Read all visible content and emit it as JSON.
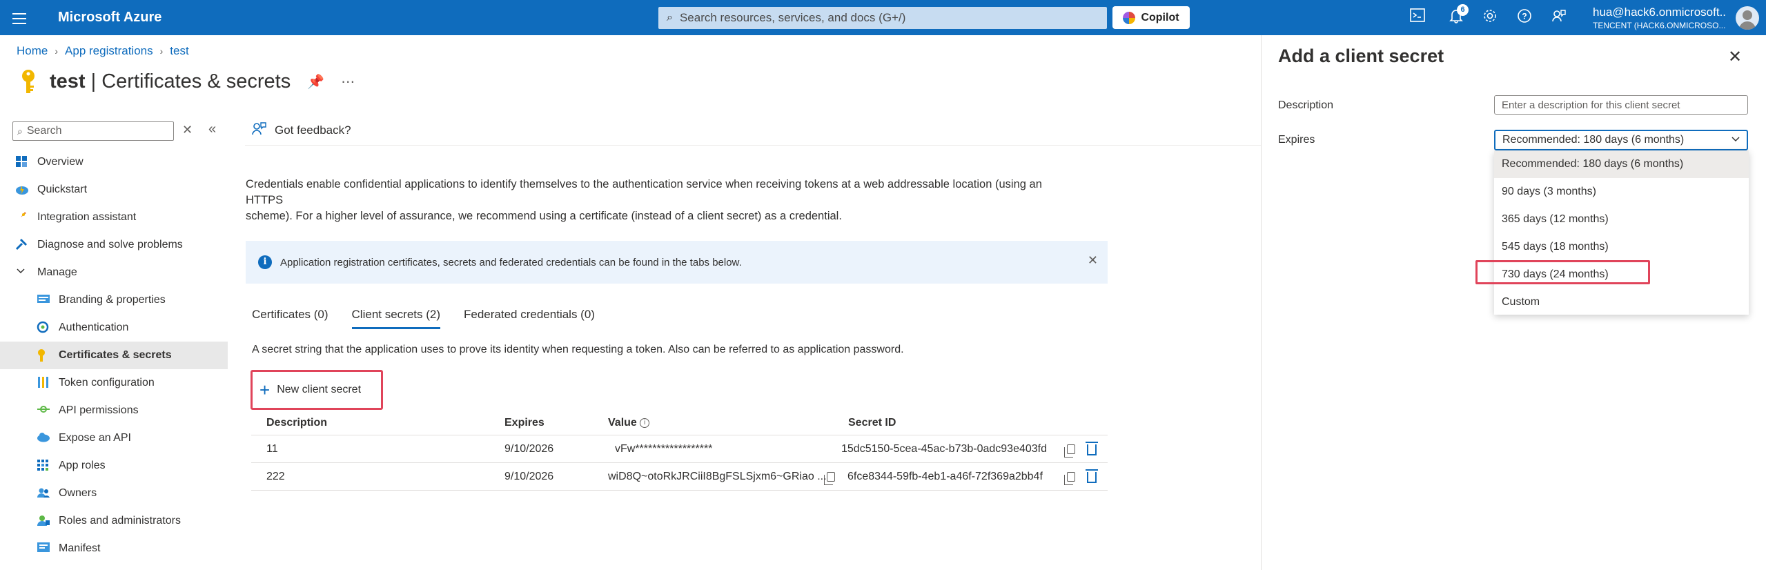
{
  "topbar": {
    "brand": "Microsoft Azure",
    "search_placeholder": "Search resources, services, and docs (G+/)",
    "copilot_label": "Copilot",
    "notification_count": "6",
    "user_email": "hua@hack6.onmicrosoft...",
    "user_tenant": "TENCENT (HACK6.ONMICROSO...",
    "accent": "#0f6cbd"
  },
  "breadcrumb": [
    "Home",
    "App registrations",
    "test"
  ],
  "page": {
    "title_app": "test",
    "title_sep": " | ",
    "title_section": "Certificates & secrets"
  },
  "sidebar": {
    "search_placeholder": "Search",
    "items": [
      {
        "label": "Overview",
        "icon": "grid-icon"
      },
      {
        "label": "Quickstart",
        "icon": "cloud-bolt-icon"
      },
      {
        "label": "Integration assistant",
        "icon": "rocket-icon"
      },
      {
        "label": "Diagnose and solve problems",
        "icon": "wrench-icon"
      },
      {
        "label": "Manage",
        "icon": "chevron-down-icon"
      },
      {
        "label": "Branding & properties",
        "icon": "branding-icon"
      },
      {
        "label": "Authentication",
        "icon": "authentication-icon"
      },
      {
        "label": "Certificates & secrets",
        "icon": "key-icon"
      },
      {
        "label": "Token configuration",
        "icon": "token-icon"
      },
      {
        "label": "API permissions",
        "icon": "api-permissions-icon"
      },
      {
        "label": "Expose an API",
        "icon": "cloud-icon"
      },
      {
        "label": "App roles",
        "icon": "app-roles-icon"
      },
      {
        "label": "Owners",
        "icon": "people-icon"
      },
      {
        "label": "Roles and administrators",
        "icon": "roles-icon"
      },
      {
        "label": "Manifest",
        "icon": "manifest-icon"
      }
    ]
  },
  "main": {
    "feedback": "Got feedback?",
    "intro_line1": "Credentials enable confidential applications to identify themselves to the authentication service when receiving tokens at a web addressable location (using an HTTPS",
    "intro_line2": "scheme). For a higher level of assurance, we recommend using a certificate (instead of a client secret) as a credential.",
    "info_text": "Application registration certificates, secrets and federated credentials can be found in the tabs below.",
    "tabs": [
      "Certificates (0)",
      "Client secrets (2)",
      "Federated credentials (0)"
    ],
    "tab_description": "A secret string that the application uses to prove its identity when requesting a token. Also can be referred to as application password.",
    "new_secret_label": "New client secret",
    "table": {
      "headers": [
        "Description",
        "Expires",
        "Value",
        "Secret ID"
      ],
      "rows": [
        {
          "description": "11",
          "expires": "9/10/2026",
          "value": "vFw******************",
          "secret_id": "15dc5150-5cea-45ac-b73b-0adc93e403fd"
        },
        {
          "description": "222",
          "expires": "9/10/2026",
          "value": "wiD8Q~otoRkJRCiiI8BgFSLSjxm6~GRiao ...",
          "secret_id": "6fce8344-59fb-4eb1-a46f-72f369a2bb4f"
        }
      ]
    }
  },
  "panel": {
    "title": "Add a client secret",
    "description_label": "Description",
    "description_placeholder": "Enter a description for this client secret",
    "expires_label": "Expires",
    "expires_value": "Recommended: 180 days (6 months)",
    "options": [
      "Recommended: 180 days (6 months)",
      "90 days (3 months)",
      "365 days (12 months)",
      "545 days (18 months)",
      "730 days (24 months)",
      "Custom"
    ]
  }
}
